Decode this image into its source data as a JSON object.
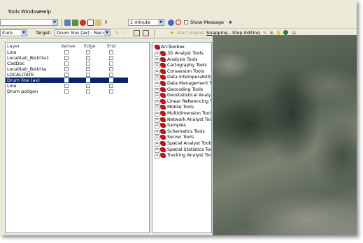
{
  "menubar": {
    "items": [
      "Tools",
      "Window",
      "Help"
    ]
  },
  "toolbar1": {
    "dropdown_value": "",
    "interval_value": "1 minute",
    "show_message_label": "Show Message",
    "show_message_checked": false
  },
  "toolbar2": {
    "layer_combo_value": "iture",
    "target_label": "Target:",
    "target_value": "Drum line (ax) : Necunc",
    "start_editing_label": "Start Eagng",
    "snapping_label": "Snapping...",
    "stop_editing_label": "Stop Editing"
  },
  "snapping": {
    "columns": [
      "Layer",
      "Vertex",
      "Edge",
      "End"
    ],
    "rows": [
      {
        "layer": "Line",
        "vertex": false,
        "edge": false,
        "end": false,
        "selected": false
      },
      {
        "layer": "Localitati_Bistrita1",
        "vertex": false,
        "edge": false,
        "end": false,
        "selected": false
      },
      {
        "layer": "CadDoc",
        "vertex": false,
        "edge": false,
        "end": false,
        "selected": false
      },
      {
        "layer": "Localitati_Bistrita",
        "vertex": false,
        "edge": false,
        "end": false,
        "selected": false
      },
      {
        "layer": "LOCALITATE",
        "vertex": false,
        "edge": false,
        "end": false,
        "selected": false
      },
      {
        "layer": "Drum line (ax)",
        "vertex": true,
        "edge": true,
        "end": true,
        "selected": true
      },
      {
        "layer": "Line",
        "vertex": false,
        "edge": false,
        "end": false,
        "selected": false
      },
      {
        "layer": "Drum poligon",
        "vertex": false,
        "edge": false,
        "end": false,
        "selected": false
      }
    ]
  },
  "toolbox": {
    "root": "ArcToolbox",
    "items": [
      "3D Analyst Tools",
      "Analysis Tools",
      "Cartography Tools",
      "Conversion Tools",
      "Data Interoperability",
      "Data Management T",
      "Geocoding Tools",
      "Geostatistical Analys",
      "Linear Referencing T",
      "Mobile Tools",
      "Multidimension Tools",
      "Network Analyst Too",
      "Samples",
      "Schematics Tools",
      "Server Tools",
      "Spatial Analyst Tools",
      "Spatial Statistics Too",
      "Tracking Analyst Too"
    ]
  },
  "colors": {
    "chrome": "#ece9d8",
    "selection": "#0a246a",
    "tool_red": "#c0141b"
  }
}
